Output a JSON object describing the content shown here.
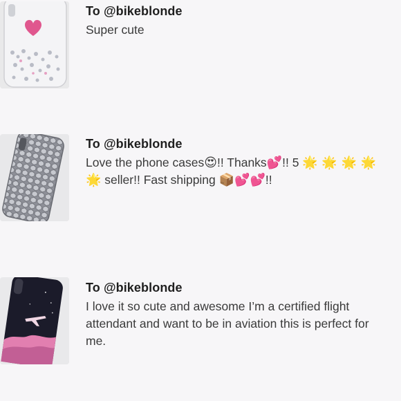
{
  "reviews": [
    {
      "recipient": "To @bikeblonde",
      "body_parts": [
        "Super cute"
      ],
      "thumbnail_icon": "glitter-heart-phone-case"
    },
    {
      "recipient": "To @bikeblonde",
      "body_parts": [
        "Love the phone cases",
        "😍",
        "!! Thanks",
        "💕",
        "!! 5 ",
        "🌟 🌟 🌟 🌟 🌟",
        " seller!! Fast shipping ",
        "📦💕💕",
        "!!"
      ],
      "thumbnail_icon": "hexagon-glitter-phone-case"
    },
    {
      "recipient": "To @bikeblonde",
      "body_parts": [
        "I love it so cute and awesome I’m a certified flight attendant and want to be in aviation this is perfect for me."
      ],
      "thumbnail_icon": "airplane-sky-phone-case"
    }
  ],
  "colors": {
    "background": "#f7f6f8",
    "heart": "#e0578e",
    "case_dark": "#1b1b2a",
    "cloud_pink": "#e27fb0"
  }
}
